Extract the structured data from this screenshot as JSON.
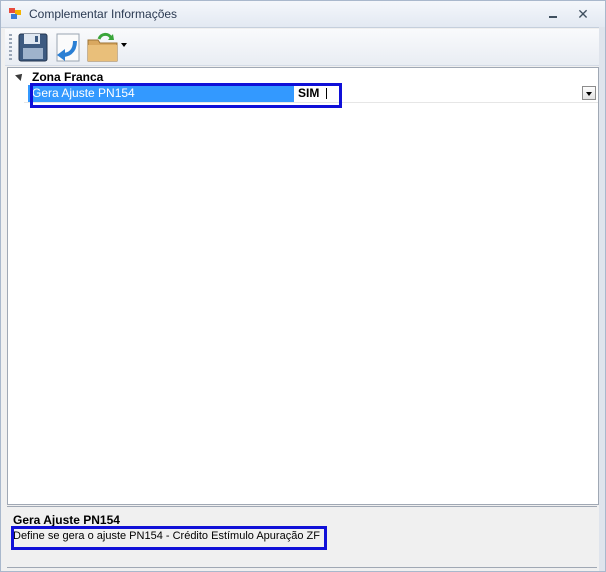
{
  "window": {
    "title": "Complementar Informações",
    "close_glyph": "✕"
  },
  "toolbar": {
    "buttons": [
      {
        "icon": "save-icon"
      },
      {
        "icon": "undo-arrow-icon"
      },
      {
        "icon": "folder-refresh-icon"
      }
    ]
  },
  "property_grid": {
    "category": "Zona Franca",
    "property": {
      "name": "Gera Ajuste PN154",
      "value": "SIM"
    }
  },
  "help": {
    "title": "Gera Ajuste PN154",
    "description": "Define se gera o ajuste PN154 - Crédito Estímulo Apuração ZF"
  },
  "colors": {
    "selection": "#3399ff",
    "highlight_box": "#1010d8"
  }
}
